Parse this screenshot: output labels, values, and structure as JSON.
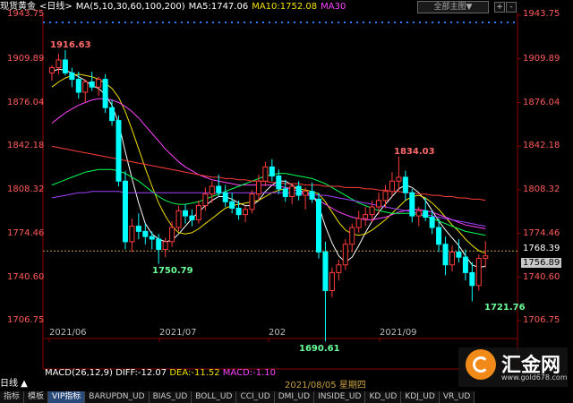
{
  "header": {
    "symbol": "现货黄金",
    "period": "<日线>",
    "ma_label": "MA(5,10,30,60,100,200)",
    "ma5": "MA5:1747.06",
    "ma10": "MA10:1752.08",
    "ma30": "MA30",
    "mode_button": "全部主图▼",
    "zoom_in": "+",
    "zoom_out": "-"
  },
  "price_axis": [
    "1943.75",
    "1909.89",
    "1876.04",
    "1842.18",
    "1808.32",
    "1774.46",
    "1740.60",
    "1706.75"
  ],
  "current_price": "1768.39",
  "cursor_price": "1756.89",
  "dates": [
    "2021/06",
    "2021/07",
    "202",
    "2021/09"
  ],
  "hover_date": "2021/08/05 星期四",
  "annotations": {
    "high1": "1916.63",
    "low1": "1750.79",
    "high2": "1834.03",
    "low2": "1690.61",
    "low3": "1721.76"
  },
  "macd": {
    "label": "MACD(26,12,9)",
    "diff": "DIFF:-12.07",
    "dea": "DEA:-11.52",
    "macd": "MACD:-1.10"
  },
  "period_selector": "日线 ▲",
  "tabs": [
    "指标",
    "模板",
    "VIP指标",
    "BARUPDN_UD",
    "BIAS_UD",
    "BOLL_UD",
    "CCI_UD",
    "DMI_UD",
    "INSIDE_UD",
    "KD_UD",
    "KDJ_UD",
    "VR_UD"
  ],
  "logo": {
    "name": "汇金网",
    "url": "www.gold678.com"
  },
  "colors": {
    "up": "#ff3b3b",
    "down": "#00ffff",
    "ma5": "#ffffff",
    "ma10": "#f2e100",
    "ma30": "#ff45ff",
    "ma60": "#00ff55",
    "ma100": "#a040ff",
    "ma200": "#ff3b3b",
    "axis_text": "#ff5a5a",
    "dotted": "#c8a040"
  },
  "chart_data": {
    "type": "candlestick",
    "price_range": [
      1690,
      1945
    ],
    "candles": [
      [
        1899,
        1905,
        1893,
        1903
      ],
      [
        1903,
        1914,
        1898,
        1909
      ],
      [
        1909,
        1916.63,
        1897,
        1899
      ],
      [
        1899,
        1903,
        1888,
        1894
      ],
      [
        1894,
        1900,
        1879,
        1884
      ],
      [
        1884,
        1894,
        1876,
        1892
      ],
      [
        1892,
        1900,
        1885,
        1888
      ],
      [
        1888,
        1896,
        1881,
        1894
      ],
      [
        1894,
        1898,
        1868,
        1872
      ],
      [
        1872,
        1878,
        1858,
        1862
      ],
      [
        1862,
        1866,
        1811,
        1815
      ],
      [
        1815,
        1823,
        1762,
        1768
      ],
      [
        1768,
        1786,
        1760,
        1780
      ],
      [
        1780,
        1790,
        1770,
        1776
      ],
      [
        1776,
        1782,
        1766,
        1772
      ],
      [
        1772,
        1776,
        1762,
        1770
      ],
      [
        1770,
        1774,
        1750.79,
        1762
      ],
      [
        1762,
        1771,
        1756,
        1768
      ],
      [
        1768,
        1784,
        1764,
        1779
      ],
      [
        1779,
        1796,
        1776,
        1792
      ],
      [
        1792,
        1797,
        1782,
        1788
      ],
      [
        1788,
        1793,
        1780,
        1785
      ],
      [
        1785,
        1800,
        1782,
        1796
      ],
      [
        1796,
        1810,
        1792,
        1805
      ],
      [
        1805,
        1815,
        1798,
        1811
      ],
      [
        1811,
        1820,
        1803,
        1806
      ],
      [
        1806,
        1812,
        1795,
        1799
      ],
      [
        1799,
        1806,
        1790,
        1794
      ],
      [
        1794,
        1800,
        1785,
        1789
      ],
      [
        1789,
        1796,
        1783,
        1793
      ],
      [
        1793,
        1808,
        1790,
        1805
      ],
      [
        1805,
        1820,
        1800,
        1815
      ],
      [
        1815,
        1830,
        1811,
        1826
      ],
      [
        1826,
        1832,
        1815,
        1819
      ],
      [
        1819,
        1824,
        1805,
        1809
      ],
      [
        1809,
        1816,
        1799,
        1803
      ],
      [
        1803,
        1813,
        1797,
        1811
      ],
      [
        1811,
        1815,
        1800,
        1804
      ],
      [
        1804,
        1810,
        1793,
        1807
      ],
      [
        1807,
        1814,
        1798,
        1801
      ],
      [
        1801,
        1806,
        1755,
        1760
      ],
      [
        1760,
        1768,
        1690.61,
        1730
      ],
      [
        1730,
        1748,
        1725,
        1744
      ],
      [
        1744,
        1754,
        1738,
        1750
      ],
      [
        1750,
        1770,
        1746,
        1766
      ],
      [
        1766,
        1782,
        1760,
        1779
      ],
      [
        1779,
        1792,
        1775,
        1786
      ],
      [
        1786,
        1795,
        1780,
        1789
      ],
      [
        1789,
        1800,
        1783,
        1795
      ],
      [
        1795,
        1806,
        1789,
        1800
      ],
      [
        1800,
        1812,
        1794,
        1807
      ],
      [
        1807,
        1822,
        1803,
        1815
      ],
      [
        1815,
        1834.03,
        1808,
        1818
      ],
      [
        1818,
        1823,
        1800,
        1806
      ],
      [
        1806,
        1809,
        1783,
        1788
      ],
      [
        1788,
        1795,
        1780,
        1792
      ],
      [
        1792,
        1802,
        1784,
        1787
      ],
      [
        1787,
        1792,
        1774,
        1779
      ],
      [
        1779,
        1786,
        1760,
        1766
      ],
      [
        1766,
        1772,
        1742,
        1750
      ],
      [
        1750,
        1765,
        1745,
        1760
      ],
      [
        1760,
        1770,
        1752,
        1756
      ],
      [
        1756,
        1762,
        1738,
        1744
      ],
      [
        1744,
        1752,
        1721.76,
        1734
      ],
      [
        1734,
        1758,
        1730,
        1755
      ],
      [
        1755,
        1768.39,
        1748,
        1757
      ]
    ],
    "ma_series": [
      {
        "name": "MA5",
        "values": [
          1900,
          1902,
          1901,
          1899,
          1896,
          1893,
          1889,
          1887,
          1882,
          1874,
          1860,
          1838,
          1817,
          1798,
          1782,
          1774,
          1770,
          1768,
          1769,
          1774,
          1780,
          1786,
          1791,
          1796,
          1800,
          1803,
          1803,
          1801,
          1798,
          1796,
          1796,
          1800,
          1807,
          1812,
          1815,
          1815,
          1812,
          1808,
          1806,
          1805,
          1796,
          1780,
          1767,
          1757,
          1752,
          1756,
          1765,
          1775,
          1784,
          1791,
          1797,
          1803,
          1809,
          1812,
          1810,
          1806,
          1800,
          1792,
          1784,
          1777,
          1771,
          1765,
          1757,
          1750,
          1748,
          1749
        ]
      },
      {
        "name": "MA10",
        "values": [
          1888,
          1892,
          1895,
          1897,
          1898,
          1897,
          1896,
          1894,
          1891,
          1887,
          1880,
          1869,
          1855,
          1840,
          1825,
          1811,
          1798,
          1788,
          1780,
          1775,
          1774,
          1775,
          1778,
          1782,
          1786,
          1790,
          1794,
          1796,
          1797,
          1798,
          1799,
          1800,
          1803,
          1806,
          1808,
          1809,
          1810,
          1809,
          1808,
          1807,
          1805,
          1799,
          1791,
          1783,
          1777,
          1774,
          1773,
          1774,
          1777,
          1781,
          1785,
          1790,
          1795,
          1800,
          1803,
          1804,
          1802,
          1798,
          1793,
          1787,
          1781,
          1776,
          1770,
          1765,
          1761,
          1759
        ]
      },
      {
        "name": "MA30",
        "values": [
          1860,
          1864,
          1868,
          1871,
          1874,
          1876,
          1878,
          1879,
          1879,
          1878,
          1876,
          1873,
          1869,
          1864,
          1858,
          1852,
          1846,
          1840,
          1835,
          1830,
          1826,
          1823,
          1820,
          1818,
          1816,
          1815,
          1814,
          1813,
          1812,
          1812,
          1812,
          1812,
          1812,
          1812,
          1811,
          1810,
          1809,
          1807,
          1805,
          1803,
          1800,
          1797,
          1794,
          1791,
          1789,
          1787,
          1786,
          1785,
          1785,
          1786,
          1787,
          1789,
          1791,
          1792,
          1793,
          1793,
          1792,
          1791,
          1789,
          1787,
          1785,
          1783,
          1781,
          1780,
          1779,
          1778
        ]
      },
      {
        "name": "MA60",
        "values": [
          1812,
          1814,
          1816,
          1818,
          1820,
          1822,
          1823,
          1824,
          1824,
          1824,
          1823,
          1821,
          1818,
          1815,
          1811,
          1807,
          1803,
          1800,
          1798,
          1797,
          1797,
          1798,
          1799,
          1801,
          1803,
          1805,
          1807,
          1809,
          1811,
          1813,
          1815,
          1817,
          1819,
          1820,
          1821,
          1821,
          1820,
          1819,
          1818,
          1817,
          1815,
          1813,
          1810,
          1807,
          1804,
          1801,
          1798,
          1796,
          1794,
          1792,
          1791,
          1790,
          1790,
          1790,
          1790,
          1789,
          1788,
          1786,
          1784,
          1782,
          1780,
          1778,
          1776,
          1775,
          1774,
          1773
        ]
      },
      {
        "name": "MA100",
        "values": [
          1802,
          1803,
          1804,
          1805,
          1806,
          1806,
          1807,
          1807,
          1807,
          1807,
          1807,
          1806,
          1806,
          1806,
          1806,
          1806,
          1806,
          1806,
          1806,
          1806,
          1806,
          1806,
          1806,
          1806,
          1806,
          1806,
          1806,
          1806,
          1806,
          1806,
          1806,
          1806,
          1806,
          1806,
          1806,
          1806,
          1806,
          1805,
          1805,
          1805,
          1804,
          1804,
          1803,
          1802,
          1801,
          1800,
          1799,
          1798,
          1797,
          1796,
          1795,
          1794,
          1793,
          1792,
          1791,
          1790,
          1789,
          1788,
          1787,
          1786,
          1785,
          1784,
          1783,
          1782,
          1781,
          1780
        ]
      },
      {
        "name": "MA200",
        "values": [
          1842,
          1841,
          1840,
          1839,
          1838,
          1837,
          1836,
          1835,
          1834,
          1833,
          1832,
          1831,
          1830,
          1829,
          1828,
          1827,
          1826,
          1825,
          1824,
          1823,
          1822,
          1821,
          1820,
          1819,
          1818,
          1818,
          1817,
          1817,
          1816,
          1816,
          1815,
          1815,
          1815,
          1814,
          1814,
          1813,
          1813,
          1813,
          1812,
          1812,
          1812,
          1811,
          1811,
          1811,
          1810,
          1810,
          1810,
          1809,
          1809,
          1808,
          1808,
          1807,
          1807,
          1806,
          1806,
          1805,
          1805,
          1804,
          1804,
          1803,
          1803,
          1802,
          1802,
          1801,
          1801,
          1800
        ]
      }
    ]
  }
}
